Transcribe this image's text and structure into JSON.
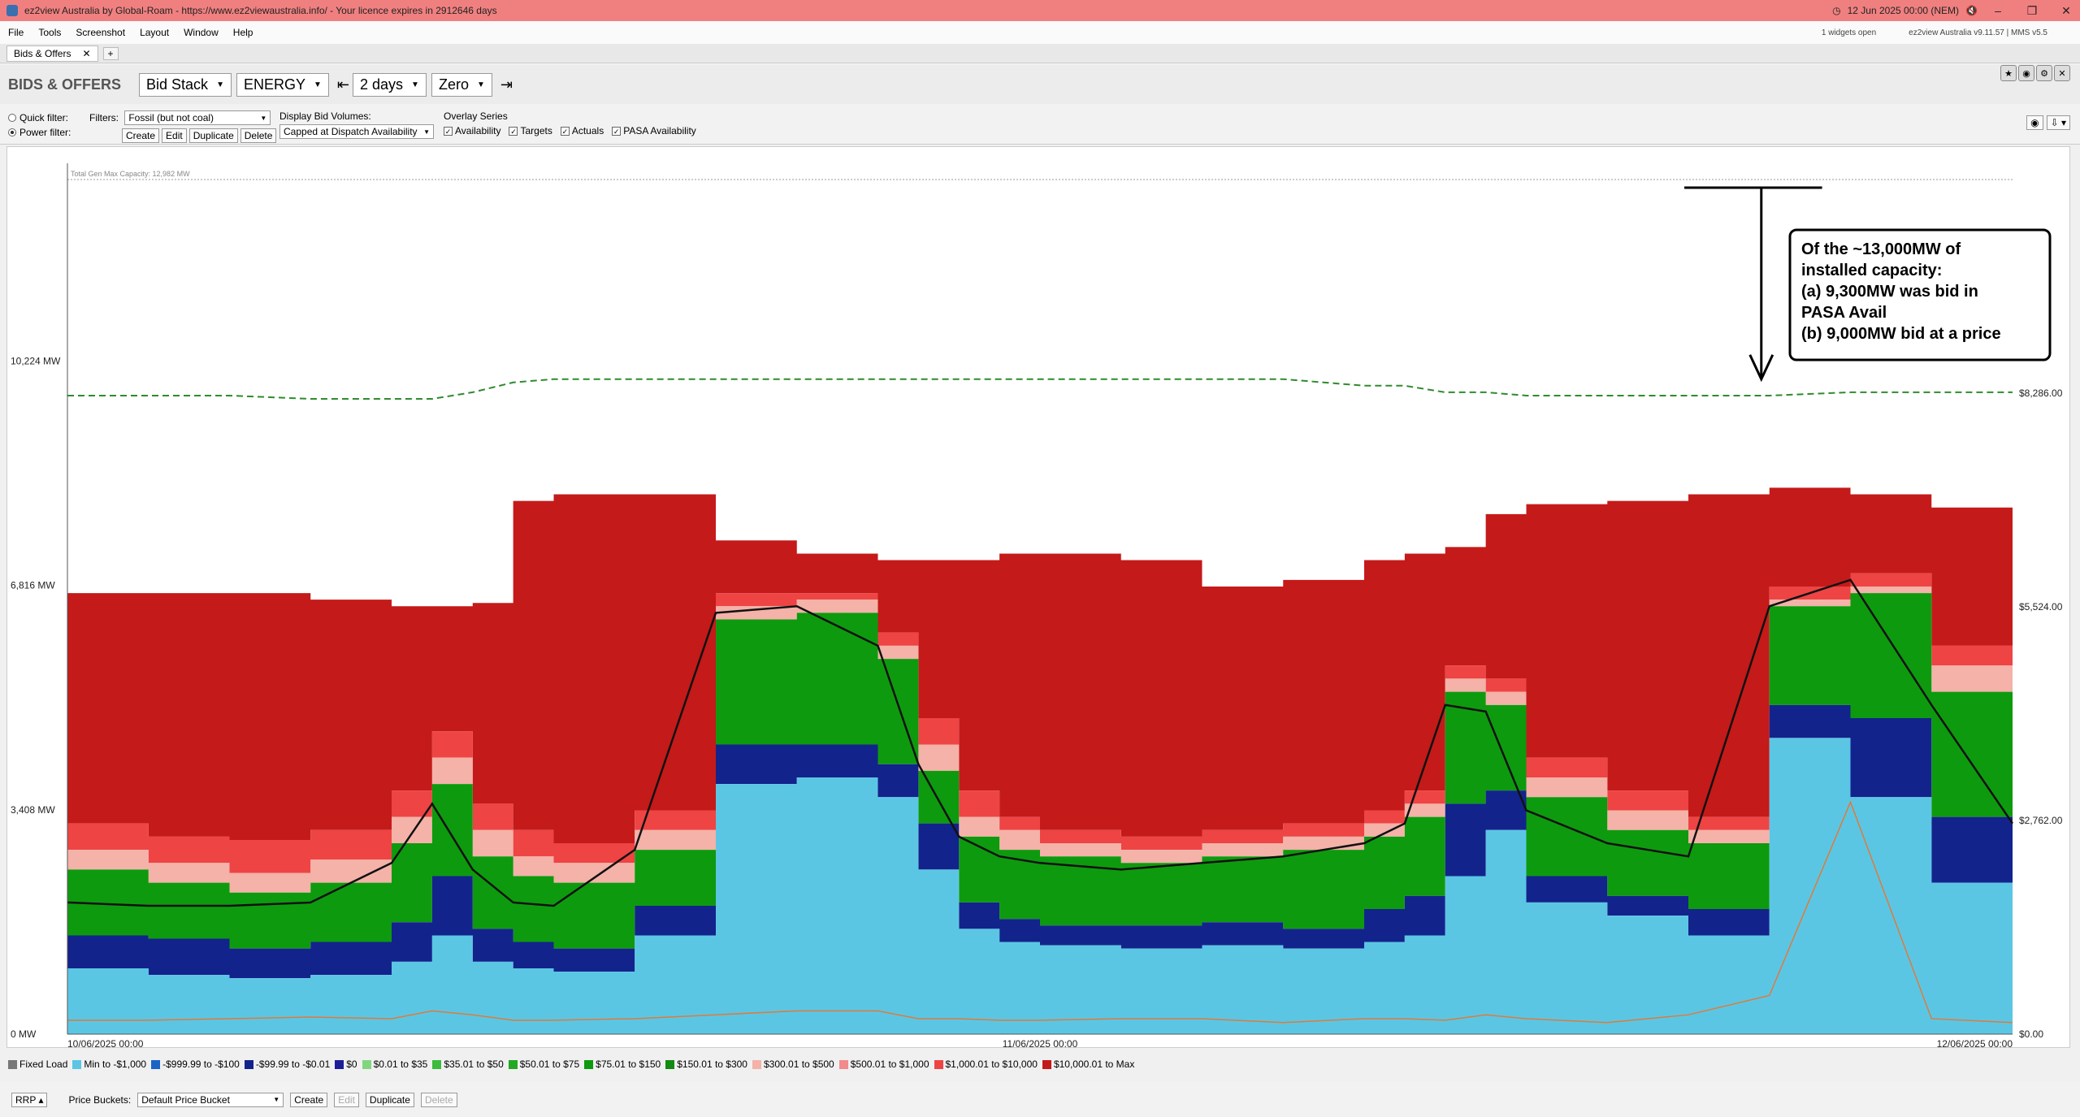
{
  "window": {
    "title": "ez2view Australia by Global-Roam - https://www.ez2viewaustralia.info/ - Your licence expires in 2912646 days",
    "clock": "12 Jun 2025 00:00 (NEM)"
  },
  "menu": [
    "File",
    "Tools",
    "Screenshot",
    "Layout",
    "Window",
    "Help"
  ],
  "status": {
    "widgets": "1 widgets open",
    "version": "ez2view Australia v9.11.57 | MMS v5.5"
  },
  "tab": {
    "label": "Bids & Offers",
    "add": "+"
  },
  "toolbar": {
    "heading": "BIDS & OFFERS",
    "view_select": "Bid Stack",
    "type_select": "ENERGY",
    "period_select": "2 days",
    "zero_select": "Zero"
  },
  "filters": {
    "quick_label": "Quick filter:",
    "power_label": "Power filter:",
    "filters_label": "Filters:",
    "filter_value": "Fossil (but not coal)",
    "create": "Create",
    "edit": "Edit",
    "duplicate": "Duplicate",
    "delete": "Delete",
    "display_label": "Display Bid Volumes:",
    "display_value": "Capped at Dispatch Availability",
    "overlay_label": "Overlay Series",
    "overlays": [
      "Availability",
      "Targets",
      "Actuals",
      "PASA Availability"
    ]
  },
  "chart_data": {
    "type": "area",
    "max_capacity_label": "Total Gen Max Capacity: 12,982 MW",
    "y_ticks": [
      "0 MW",
      "3,408 MW",
      "6,816 MW",
      "10,224 MW"
    ],
    "y_range_mw": [
      0,
      12982
    ],
    "y2_ticks": [
      "$0.00",
      "$2,762.00",
      "$5,524.00",
      "$8,286.00"
    ],
    "y2_range": [
      0,
      11048
    ],
    "x_labels": [
      "10/06/2025 00:00",
      "11/06/2025 00:00",
      "12/06/2025 00:00"
    ],
    "x_range_hours": [
      0,
      48
    ],
    "annotation": [
      "Of the ~13,000MW of",
      "installed capacity:",
      "(a)  9,300MW was bid in",
      "PASA Avail",
      "(b)  9,000MW bid at a price"
    ],
    "bands": [
      {
        "name": "Min to -$1,000",
        "color": "#5bc6e4"
      },
      {
        "name": "-$999.99 to -$100",
        "color": "#1a64c8"
      },
      {
        "name": "-$99.99 to -$0.01",
        "color": "#13238c"
      },
      {
        "name": "$0",
        "color": "#1d1d9a"
      },
      {
        "name": "$0.01 to $35",
        "color": "#7fd67f"
      },
      {
        "name": "$35.01 to $50",
        "color": "#3cbb3c"
      },
      {
        "name": "$50.01 to $75",
        "color": "#22a822"
      },
      {
        "name": "$75.01 to $150",
        "color": "#0e9a0e"
      },
      {
        "name": "$150.01 to $300",
        "color": "#138a13"
      },
      {
        "name": "$300.01 to $500",
        "color": "#f4b2a8"
      },
      {
        "name": "$500.01 to $1,000",
        "color": "#f28b8b"
      },
      {
        "name": "$1,000.01 to $10,000",
        "color": "#ee4444"
      },
      {
        "name": "$10,000.01 to Max",
        "color": "#c41a1a"
      }
    ],
    "legend_extra": {
      "name": "Fixed Load",
      "color": "#777777"
    },
    "time_h": [
      0,
      2,
      4,
      6,
      8,
      9,
      10,
      11,
      12,
      14,
      16,
      18,
      20,
      21,
      22,
      23,
      24,
      26,
      28,
      30,
      32,
      33,
      34,
      35,
      36,
      38,
      40,
      42,
      44,
      46,
      48
    ],
    "stack_top_mw": [
      6700,
      6700,
      6700,
      6600,
      6500,
      6500,
      6550,
      8100,
      8200,
      8200,
      7500,
      7300,
      7200,
      7200,
      7200,
      7300,
      7300,
      7200,
      6800,
      6900,
      7200,
      7300,
      7400,
      7900,
      8050,
      8100,
      8200,
      8300,
      8200,
      8000,
      7850
    ],
    "cumulative_mw": {
      "blue": [
        1000,
        900,
        850,
        900,
        1100,
        1500,
        1100,
        1000,
        950,
        1500,
        3800,
        3900,
        3600,
        2500,
        1600,
        1400,
        1350,
        1300,
        1350,
        1300,
        1400,
        1500,
        2400,
        3100,
        2000,
        1800,
        1500,
        4500,
        3600,
        2300,
        1500
      ],
      "navy": [
        1500,
        1450,
        1300,
        1400,
        1700,
        2400,
        1600,
        1400,
        1300,
        1950,
        4400,
        4400,
        4100,
        3200,
        2000,
        1750,
        1650,
        1650,
        1700,
        1600,
        1900,
        2100,
        3500,
        3700,
        2400,
        2100,
        1900,
        5000,
        4800,
        3300,
        2100
      ],
      "green": [
        2500,
        2300,
        2150,
        2300,
        2900,
        3800,
        2700,
        2400,
        2300,
        2800,
        6300,
        6400,
        5700,
        4000,
        3000,
        2800,
        2700,
        2600,
        2700,
        2800,
        3000,
        3300,
        5200,
        5000,
        3600,
        3100,
        2900,
        6500,
        6700,
        5200,
        3500
      ],
      "pink": [
        2800,
        2600,
        2450,
        2650,
        3300,
        4200,
        3100,
        2700,
        2600,
        3100,
        6500,
        6600,
        5900,
        4400,
        3300,
        3100,
        2900,
        2800,
        2900,
        3000,
        3200,
        3500,
        5400,
        5200,
        3900,
        3400,
        3100,
        6600,
        6800,
        5600,
        3700
      ],
      "red": [
        3200,
        3000,
        2950,
        3100,
        3700,
        4600,
        3500,
        3100,
        2900,
        3400,
        6700,
        6700,
        6100,
        4800,
        3700,
        3300,
        3100,
        3000,
        3100,
        3200,
        3400,
        3700,
        5600,
        5400,
        4200,
        3700,
        3300,
        6800,
        7000,
        5900,
        4000
      ]
    },
    "availability_mw": [
      2000,
      1950,
      1950,
      2000,
      2600,
      3500,
      2500,
      2000,
      1950,
      2800,
      6400,
      6500,
      5900,
      4100,
      3000,
      2700,
      2600,
      2500,
      2600,
      2700,
      2900,
      3200,
      5000,
      4900,
      3400,
      2900,
      2700,
      6500,
      6900,
      5000,
      3200
    ],
    "pasa_mw": [
      9700,
      9700,
      9700,
      9650,
      9650,
      9650,
      9750,
      9900,
      9950,
      9950,
      9950,
      9950,
      9950,
      9950,
      9950,
      9950,
      9950,
      9950,
      9950,
      9950,
      9850,
      9850,
      9750,
      9750,
      9700,
      9700,
      9700,
      9700,
      9750,
      9750,
      9750
    ],
    "price_rrp": [
      180,
      180,
      200,
      220,
      200,
      300,
      250,
      180,
      180,
      200,
      250,
      300,
      300,
      200,
      200,
      180,
      180,
      200,
      200,
      150,
      200,
      200,
      180,
      250,
      200,
      150,
      250,
      500,
      3000,
      200,
      150
    ]
  },
  "bottom": {
    "rrp": "RRP",
    "buckets_label": "Price Buckets:",
    "bucket_value": "Default Price Bucket",
    "create": "Create",
    "edit": "Edit",
    "duplicate": "Duplicate",
    "delete": "Delete"
  }
}
